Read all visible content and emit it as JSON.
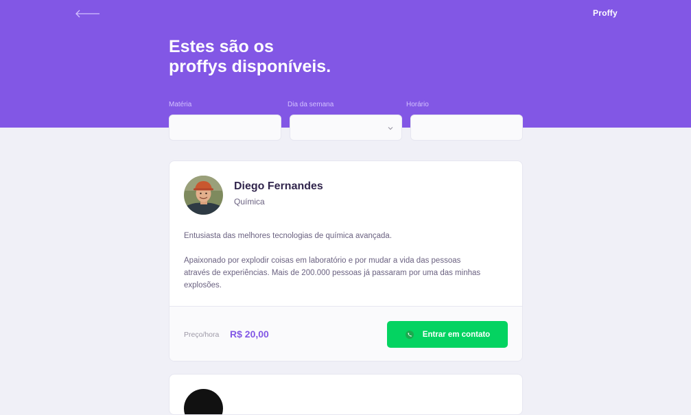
{
  "header": {
    "back_icon": "arrow-left-icon",
    "logo": "Proffy",
    "title_line1": "Estes são os",
    "title_line2": "proffys disponíveis."
  },
  "filters": {
    "subject": {
      "label": "Matéria",
      "value": ""
    },
    "weekday": {
      "label": "Dia da semana",
      "value": "",
      "icon": "chevron-down-icon"
    },
    "time": {
      "label": "Horário",
      "value": ""
    }
  },
  "teachers": [
    {
      "name": "Diego Fernandes",
      "subject": "Química",
      "bio_p1": "Entusiasta das melhores tecnologias de química avançada.",
      "bio_p2": "Apaixonado por explodir coisas em laboratório e por mudar a vida das pessoas através de experiências. Mais de 200.000 pessoas já passaram por uma das minhas explosões.",
      "price_label": "Preço/hora",
      "price": "R$ 20,00",
      "contact_label": "Entrar em contato",
      "contact_icon": "whatsapp-icon"
    }
  ],
  "colors": {
    "primary": "#8257E5",
    "background": "#F0F0F7",
    "contact_green": "#04D361",
    "title_text": "#32264D",
    "body_text": "#6A6180"
  }
}
